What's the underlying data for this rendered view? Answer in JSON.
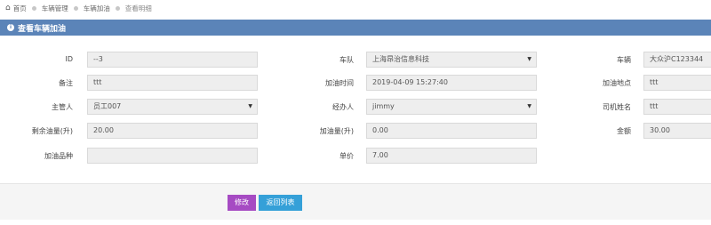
{
  "breadcrumb": [
    "首页",
    "车辆管理",
    "车辆加油",
    "查看明细"
  ],
  "panel": {
    "title": "查看车辆加油"
  },
  "form": {
    "id_label": "ID",
    "id_value": "--3",
    "fleet_label": "车队",
    "fleet_value": "上海昂治信息科技",
    "vehicle_label": "车辆",
    "vehicle_value": "大众沪C123344",
    "remark_label": "备注",
    "remark_value": "ttt",
    "refuel_time_label": "加油时间",
    "refuel_time_value": "2019-04-09 15:27:40",
    "refuel_location_label": "加油地点",
    "refuel_location_value": "ttt",
    "manager_label": "主管人",
    "manager_value": "员工007",
    "handler_label": "经办人",
    "handler_value": "jimmy",
    "driver_label": "司机姓名",
    "driver_value": "ttt",
    "remaining_fuel_label": "剩余油量(升)",
    "remaining_fuel_value": "20.00",
    "refuel_amount_label": "加油量(升)",
    "refuel_amount_value": "0.00",
    "amount_label": "金额",
    "amount_value": "30.00",
    "fuel_type_label": "加油品种",
    "fuel_type_value": "",
    "unit_price_label": "单价",
    "unit_price_value": "7.00"
  },
  "buttons": {
    "edit": "修改",
    "back": "返回列表"
  },
  "colors": {
    "header": "#5b84b8",
    "edit": "#a64bc3",
    "back": "#35a0d8"
  }
}
